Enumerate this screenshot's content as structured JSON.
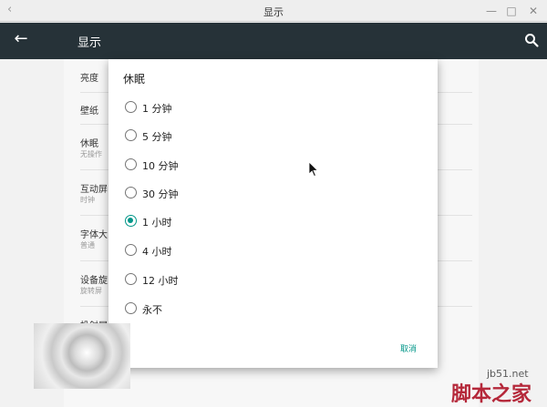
{
  "window": {
    "back_glyph": "‹",
    "title": "显示",
    "minimize_glyph": "—",
    "maximize_glyph": "□",
    "close_glyph": "✕"
  },
  "appbar": {
    "back_glyph": "←",
    "title": "显示"
  },
  "settings": [
    {
      "title": "亮度",
      "subtitle": ""
    },
    {
      "title": "壁纸",
      "subtitle": ""
    },
    {
      "title": "休眠",
      "subtitle": "无操作"
    },
    {
      "title": "互动屏",
      "subtitle": "时钟"
    },
    {
      "title": "字体大",
      "subtitle": "普通"
    },
    {
      "title": "设备旋",
      "subtitle": "旋转屏"
    },
    {
      "title": "投射屏",
      "subtitle": ""
    }
  ],
  "dialog": {
    "title": "休眠",
    "options": [
      {
        "label": "1 分钟",
        "checked": false
      },
      {
        "label": "5 分钟",
        "checked": false
      },
      {
        "label": "10 分钟",
        "checked": false
      },
      {
        "label": "30 分钟",
        "checked": false
      },
      {
        "label": "1 小时",
        "checked": true
      },
      {
        "label": "4 小时",
        "checked": false
      },
      {
        "label": "12 小时",
        "checked": false
      },
      {
        "label": "永不",
        "checked": false
      }
    ],
    "cancel_label": "取消"
  },
  "watermark": {
    "url": "jb51.net",
    "name": "脚本之家"
  },
  "colors": {
    "appbar": "#263238",
    "accent": "#009688"
  }
}
